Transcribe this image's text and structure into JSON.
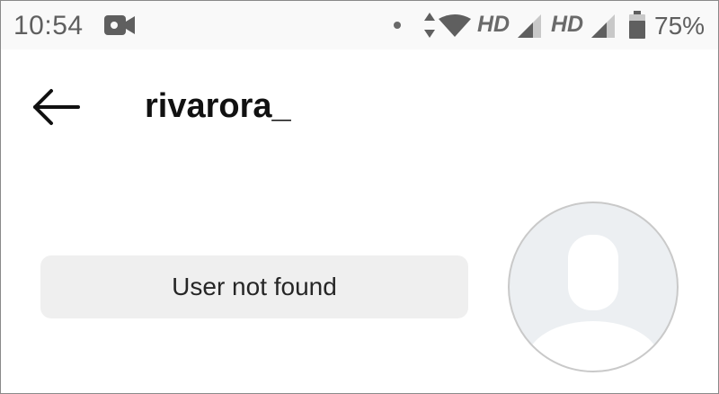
{
  "status_bar": {
    "time": "10:54",
    "network_type_1": "HD",
    "network_type_2": "HD",
    "battery_percent": "75%",
    "icons": [
      "video-camera-icon",
      "notification-dot-icon",
      "data-transfer-icon",
      "wifi-icon",
      "signal-icon",
      "signal-icon",
      "battery-icon"
    ]
  },
  "header": {
    "username": "rivarora_",
    "back_icon": "arrow-left-icon"
  },
  "main": {
    "message": "User not found",
    "avatar_icon": "default-profile-avatar-icon"
  },
  "colors": {
    "background": "#ffffff",
    "pill_background": "#efefef",
    "avatar_background": "#eceff2",
    "avatar_border": "#c9c9c9",
    "status_icons": "#5f5f5f"
  }
}
